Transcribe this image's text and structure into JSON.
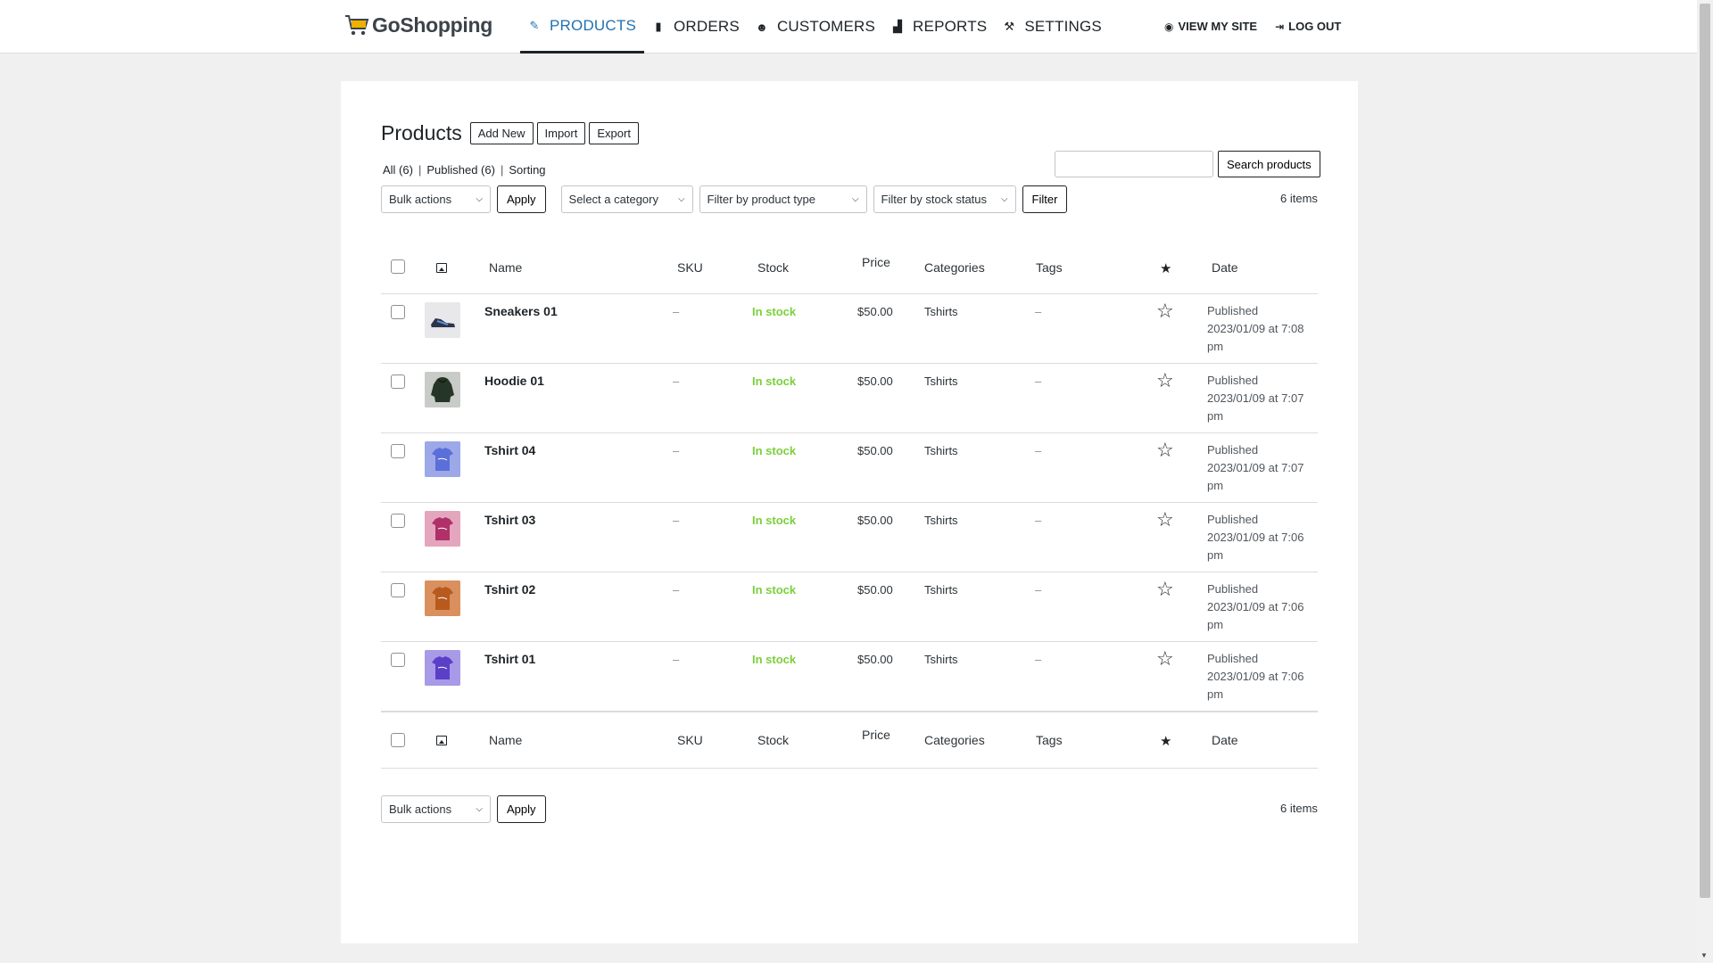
{
  "brand": {
    "name": "GoShopping",
    "icon": "shopping-cart-icon",
    "icon_color": "#f0b000"
  },
  "nav": {
    "items": [
      {
        "label": "PRODUCTS",
        "icon": "pencil-icon",
        "active": true
      },
      {
        "label": "ORDERS",
        "icon": "book-icon",
        "active": false
      },
      {
        "label": "CUSTOMERS",
        "icon": "users-icon",
        "active": false
      },
      {
        "label": "REPORTS",
        "icon": "bar-chart-icon",
        "active": false
      },
      {
        "label": "SETTINGS",
        "icon": "wrench-icon",
        "active": false
      }
    ],
    "view_site": "VIEW MY SITE",
    "log_out": "LOG OUT",
    "accent": "#2271b1"
  },
  "page": {
    "title": "Products",
    "add_new": "Add New",
    "import": "Import",
    "export": "Export",
    "views": {
      "all": "All (6)",
      "published": "Published (6)",
      "sorting": "Sorting",
      "separator": "|"
    },
    "search_placeholder": "",
    "search_button": "Search products",
    "bulk_actions": "Bulk actions",
    "apply": "Apply",
    "category_filter": "Select a category",
    "type_filter": "Filter by product type",
    "stock_filter": "Filter by stock status",
    "filter_button": "Filter",
    "item_count": "6 items"
  },
  "table": {
    "columns": {
      "name": "Name",
      "sku": "SKU",
      "stock": "Stock",
      "price": "Price",
      "categories": "Categories",
      "tags": "Tags",
      "date": "Date"
    },
    "stock_color": "#7ad03a",
    "rows": [
      {
        "name": "Sneakers 01",
        "sku": "–",
        "stock": "In stock",
        "price": "$50.00",
        "categories": "Tshirts",
        "tags": "–",
        "date_status": "Published",
        "date": "2023/01/09 at 7:08 pm",
        "thumb": "sneaker",
        "thumb_color": "#e8e8ea"
      },
      {
        "name": "Hoodie 01",
        "sku": "–",
        "stock": "In stock",
        "price": "$50.00",
        "categories": "Tshirts",
        "tags": "–",
        "date_status": "Published",
        "date": "2023/01/09 at 7:07 pm",
        "thumb": "hoodie",
        "thumb_color": "#c9cbc8"
      },
      {
        "name": "Tshirt 04",
        "sku": "–",
        "stock": "In stock",
        "price": "$50.00",
        "categories": "Tshirts",
        "tags": "–",
        "date_status": "Published",
        "date": "2023/01/09 at 7:07 pm",
        "thumb": "tshirt",
        "thumb_color": "#9ca8e8",
        "shirt_color": "#5b6fd8"
      },
      {
        "name": "Tshirt 03",
        "sku": "–",
        "stock": "In stock",
        "price": "$50.00",
        "categories": "Tshirts",
        "tags": "–",
        "date_status": "Published",
        "date": "2023/01/09 at 7:06 pm",
        "thumb": "tshirt",
        "thumb_color": "#e4a6bd",
        "shirt_color": "#b0306a"
      },
      {
        "name": "Tshirt 02",
        "sku": "–",
        "stock": "In stock",
        "price": "$50.00",
        "categories": "Tshirts",
        "tags": "–",
        "date_status": "Published",
        "date": "2023/01/09 at 7:06 pm",
        "thumb": "tshirt",
        "thumb_color": "#d9905e",
        "shirt_color": "#b85a1e"
      },
      {
        "name": "Tshirt 01",
        "sku": "–",
        "stock": "In stock",
        "price": "$50.00",
        "categories": "Tshirts",
        "tags": "–",
        "date_status": "Published",
        "date": "2023/01/09 at 7:06 pm",
        "thumb": "tshirt",
        "thumb_color": "#a89ae6",
        "shirt_color": "#5b3fc8"
      }
    ]
  }
}
